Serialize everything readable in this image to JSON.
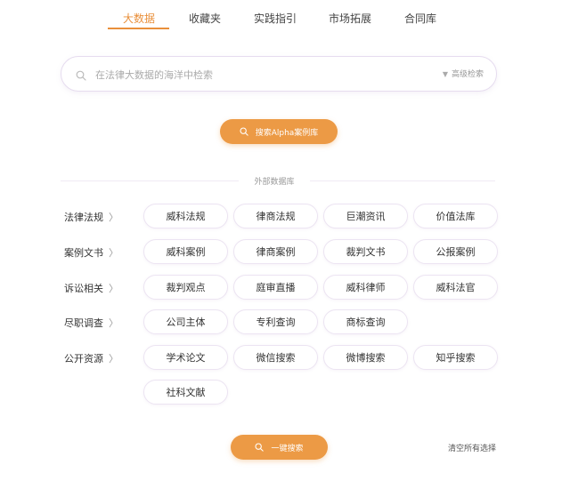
{
  "tabs": [
    {
      "label": "大数据"
    },
    {
      "label": "收藏夹"
    },
    {
      "label": "实践指引"
    },
    {
      "label": "市场拓展"
    },
    {
      "label": "合同库"
    }
  ],
  "search": {
    "placeholder": "在法律大数据的海洋中检索",
    "advanced_label": "高级检索"
  },
  "alpha_button_label": "搜索Alpha案例库",
  "external_db_label": "外部数据库",
  "categories": [
    {
      "label": "法律法规",
      "items": [
        "威科法规",
        "律商法规",
        "巨潮资讯",
        "价值法库"
      ]
    },
    {
      "label": "案例文书",
      "items": [
        "威科案例",
        "律商案例",
        "裁判文书",
        "公报案例"
      ]
    },
    {
      "label": "诉讼相关",
      "items": [
        "裁判观点",
        "庭审直播",
        "威科律师",
        "威科法官"
      ]
    },
    {
      "label": "尽职调查",
      "items": [
        "公司主体",
        "专利查询",
        "商标查询"
      ]
    },
    {
      "label": "公开资源",
      "items": [
        "学术论文",
        "微信搜索",
        "微博搜索",
        "知乎搜索",
        "社科文献"
      ]
    }
  ],
  "onekey_button_label": "一键搜索",
  "clear_all_label": "清空所有选择",
  "colors": {
    "accent": "#e98f3a",
    "button": "#ec9a45",
    "chip_border": "#ece4f2"
  }
}
